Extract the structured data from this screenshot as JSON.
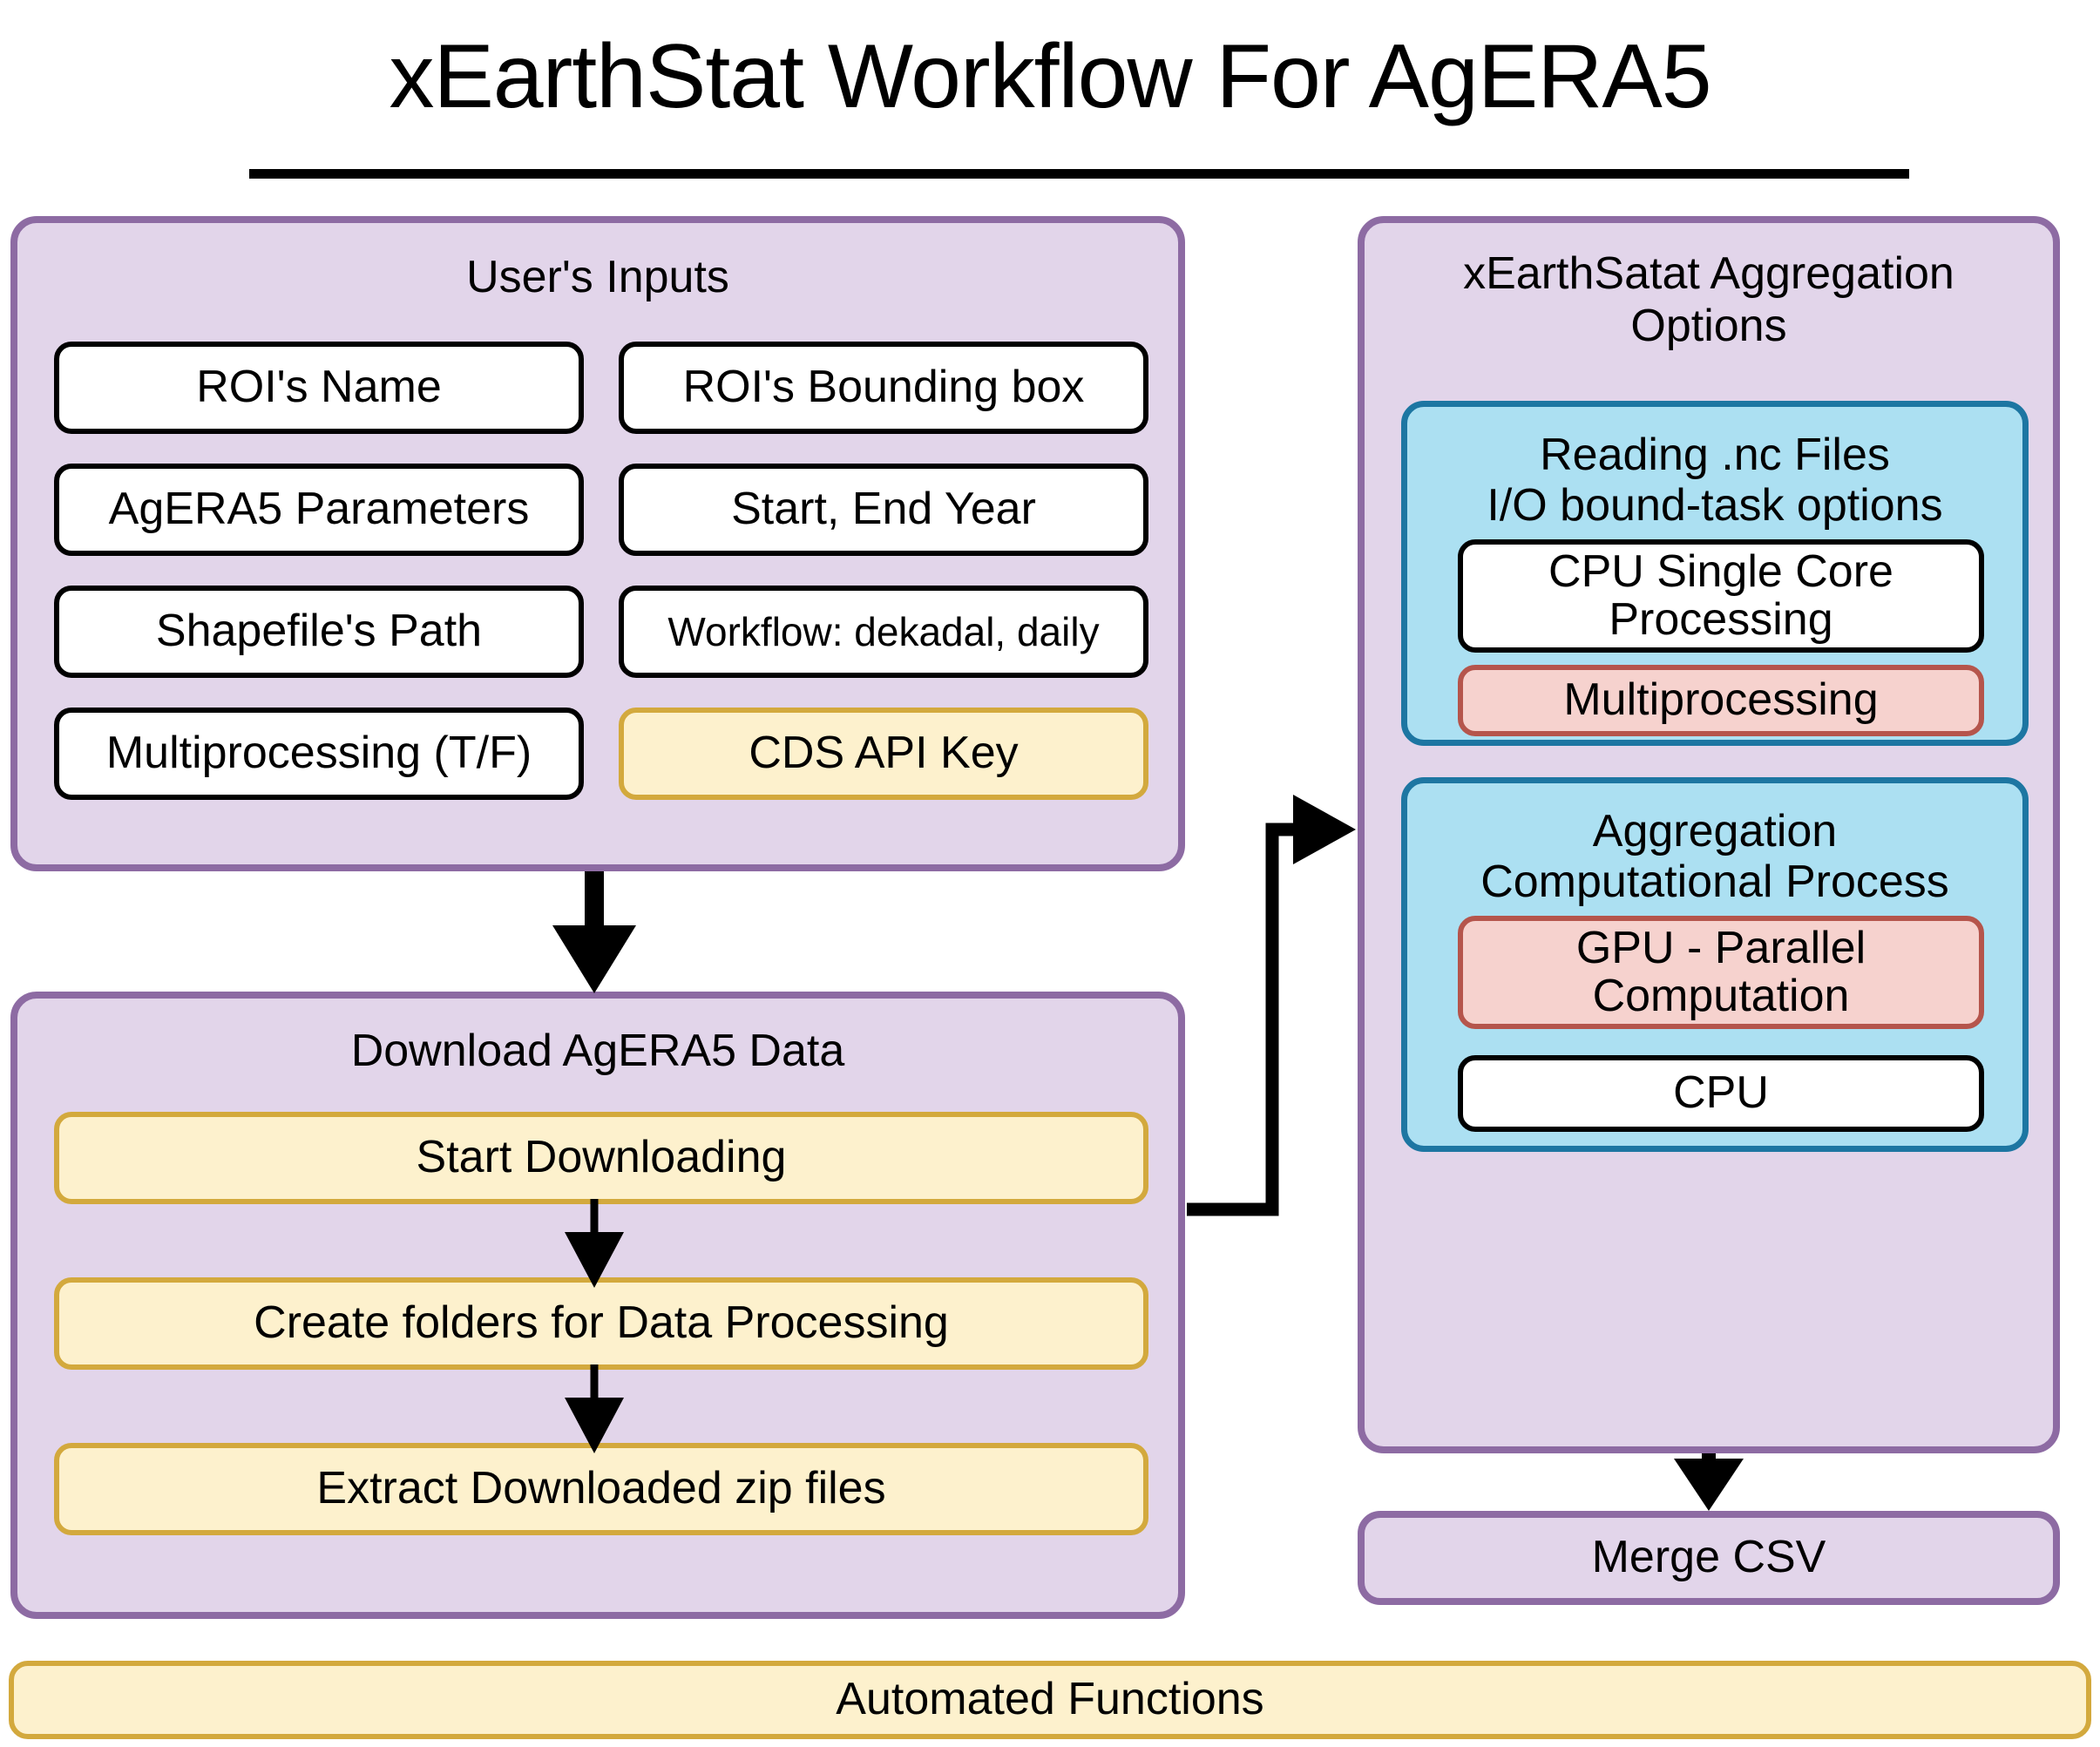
{
  "title": "xEarthStat Workflow For AgERA5",
  "colors": {
    "panel_fill": "#e2d5ea",
    "panel_border": "#8d6ba3",
    "blue_fill": "#ace0f2",
    "blue_border": "#1d76a2",
    "yellow_fill": "#fdf1cd",
    "yellow_border": "#d3a93d",
    "pink_fill": "#f6d2ce",
    "pink_border": "#b5554c",
    "white_fill": "#ffffff",
    "white_border": "#000000",
    "arrow": "#000000"
  },
  "user_inputs": {
    "title": "User's Inputs",
    "items": [
      {
        "label": "ROI's Name",
        "style": "white"
      },
      {
        "label": "ROI's Bounding box",
        "style": "white"
      },
      {
        "label": "AgERA5 Parameters",
        "style": "white"
      },
      {
        "label": "Start, End Year",
        "style": "white"
      },
      {
        "label": "Shapefile's Path",
        "style": "white"
      },
      {
        "label": "Workflow: dekadal, daily",
        "style": "white"
      },
      {
        "label": "Multiprocessing (T/F)",
        "style": "white"
      },
      {
        "label": "CDS API Key",
        "style": "yellow"
      }
    ]
  },
  "download": {
    "title": "Download AgERA5 Data",
    "steps": [
      {
        "label": "Start Downloading",
        "style": "yellow"
      },
      {
        "label": "Create folders for Data Processing",
        "style": "yellow"
      },
      {
        "label": "Extract Downloaded zip files",
        "style": "yellow"
      }
    ]
  },
  "aggregation": {
    "title_line1": "xEarthSatat Aggregation",
    "title_line2": "Options",
    "groups": [
      {
        "title_line1": "Reading .nc Files",
        "title_line2": "I/O bound-task options",
        "options": [
          {
            "label_line1": "CPU Single Core",
            "label_line2": "Processing",
            "style": "white"
          },
          {
            "label_line1": "Multiprocessing",
            "label_line2": "",
            "style": "pink"
          }
        ]
      },
      {
        "title_line1": "Aggregation",
        "title_line2": "Computational Process",
        "options": [
          {
            "label_line1": "GPU - Parallel",
            "label_line2": "Computation",
            "style": "pink"
          },
          {
            "label_line1": "CPU",
            "label_line2": "",
            "style": "white"
          }
        ]
      }
    ]
  },
  "merge": {
    "label": "Merge CSV"
  },
  "footer": {
    "label": "Automated Functions"
  }
}
